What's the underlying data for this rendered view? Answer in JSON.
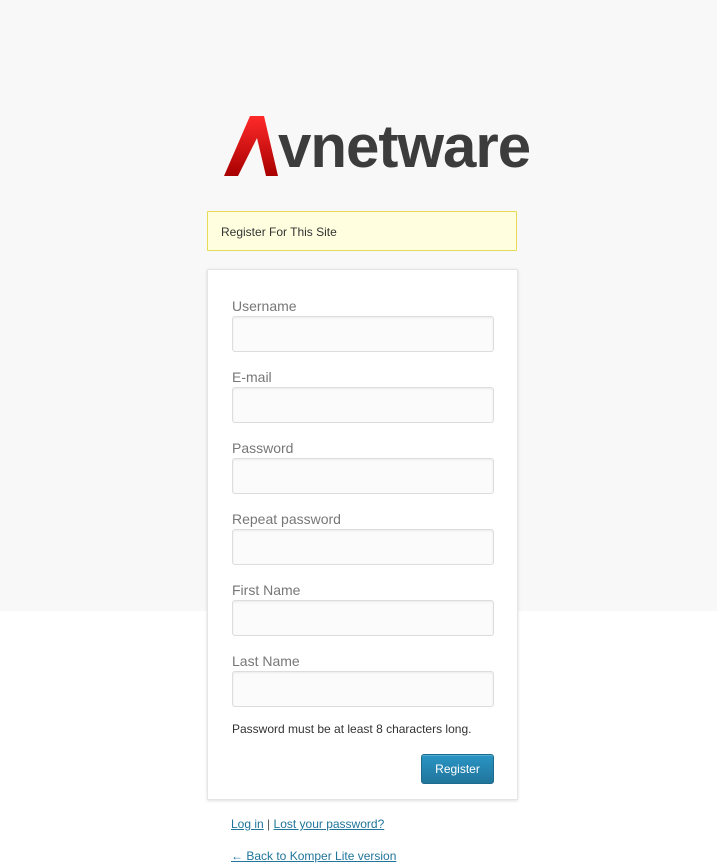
{
  "logo": {
    "text": "vnetware",
    "accent_color": "#e01b1b",
    "text_color": "#3c3c3c"
  },
  "notice": {
    "text": "Register For This Site"
  },
  "form": {
    "fields": [
      {
        "label": "Username",
        "value": ""
      },
      {
        "label": "E-mail",
        "value": ""
      },
      {
        "label": "Password",
        "value": ""
      },
      {
        "label": "Repeat password",
        "value": ""
      },
      {
        "label": "First Name",
        "value": ""
      },
      {
        "label": "Last Name",
        "value": ""
      }
    ],
    "hint": "Password must be at least 8 characters long.",
    "submit_label": "Register"
  },
  "nav": {
    "login_label": "Log in",
    "separator": "|",
    "lost_password_label": "Lost your password?",
    "back_label": "← Back to Komper Lite version"
  },
  "colors": {
    "link": "#21759b",
    "button": "#21759b",
    "notice_bg": "#ffffe0",
    "notice_border": "#e6db55"
  }
}
